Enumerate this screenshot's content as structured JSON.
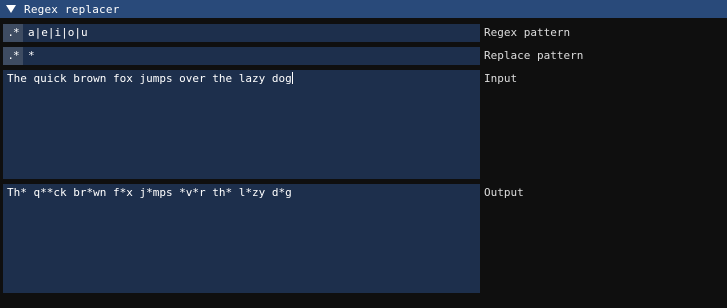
{
  "window": {
    "title": "Regex replacer"
  },
  "regex_pattern": {
    "button_label": ".*",
    "value": "a|e|i|o|u",
    "label": "Regex pattern"
  },
  "replace_pattern": {
    "button_label": ".*",
    "value": "*",
    "label": "Replace pattern"
  },
  "input": {
    "value": "The quick brown fox jumps over the lazy dog",
    "label": "Input"
  },
  "output": {
    "value": "Th* q**ck br*wn f*x j*mps *v*r th* l*zy d*g",
    "label": "Output"
  },
  "colors": {
    "titlebar": "#294a7a",
    "field_bg": "#1d2f4c",
    "button_bg": "#3e4c62",
    "window_bg": "#0f0f0f"
  },
  "icons": [
    "collapse-arrow-icon"
  ]
}
